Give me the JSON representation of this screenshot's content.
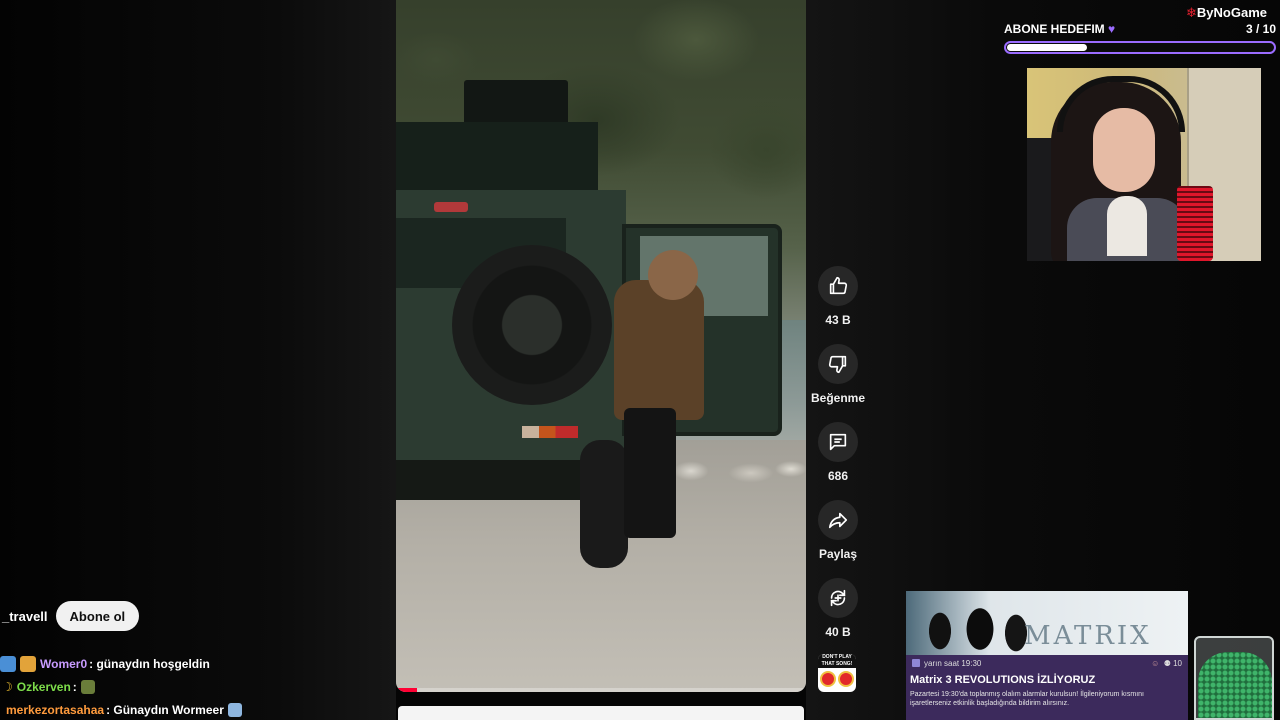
{
  "brand": {
    "text": "ByNoGame"
  },
  "sub_goal": {
    "title": "ABONE HEDEFIM",
    "current": 3,
    "target": 10,
    "count_text": "3  / 10",
    "fraction": 0.3
  },
  "video": {
    "progress": 0.05
  },
  "actions": [
    {
      "name": "like",
      "icon": "thumbs-up-icon",
      "label": "43 B"
    },
    {
      "name": "dislike",
      "icon": "thumbs-down-icon",
      "label": "Beğenme"
    },
    {
      "name": "comments",
      "icon": "comment-icon",
      "label": "686"
    },
    {
      "name": "share",
      "icon": "share-icon",
      "label": "Paylaş"
    },
    {
      "name": "remix",
      "icon": "remix-icon",
      "label": "40 B"
    }
  ],
  "sound_thumb": {
    "text": "DON'T PLAY THAT SONG!"
  },
  "channel": {
    "name": "_travell",
    "subscribe_label": "Abone ol"
  },
  "chat": [
    {
      "user": "Womer0",
      "user_color": "#c89bff",
      "message": ": günaydın hoşgeldin",
      "emote_color": "#4a8fd6"
    },
    {
      "user": "Ozkerven",
      "user_color": "#7ddc4a",
      "message": ": ",
      "emote_color": "#f2c230"
    },
    {
      "user": "merkezortasahaa",
      "user_color": "#ff9b3d",
      "message": ": Günaydın Wormeer",
      "emote_color": ""
    }
  ],
  "event": {
    "banner_logo": "MATRIX",
    "time": "yarın saat 19:30",
    "interested": "10",
    "title": "Matrix 3 REVOLUTIONS İZLİYORUZ",
    "description": "Pazartesi 19:30'da toplanmış olalım alarmlar kurulsun! İlgileniyorum kısmını işaretlerseniz etkinlik başladığında bildirim alırsınız."
  }
}
